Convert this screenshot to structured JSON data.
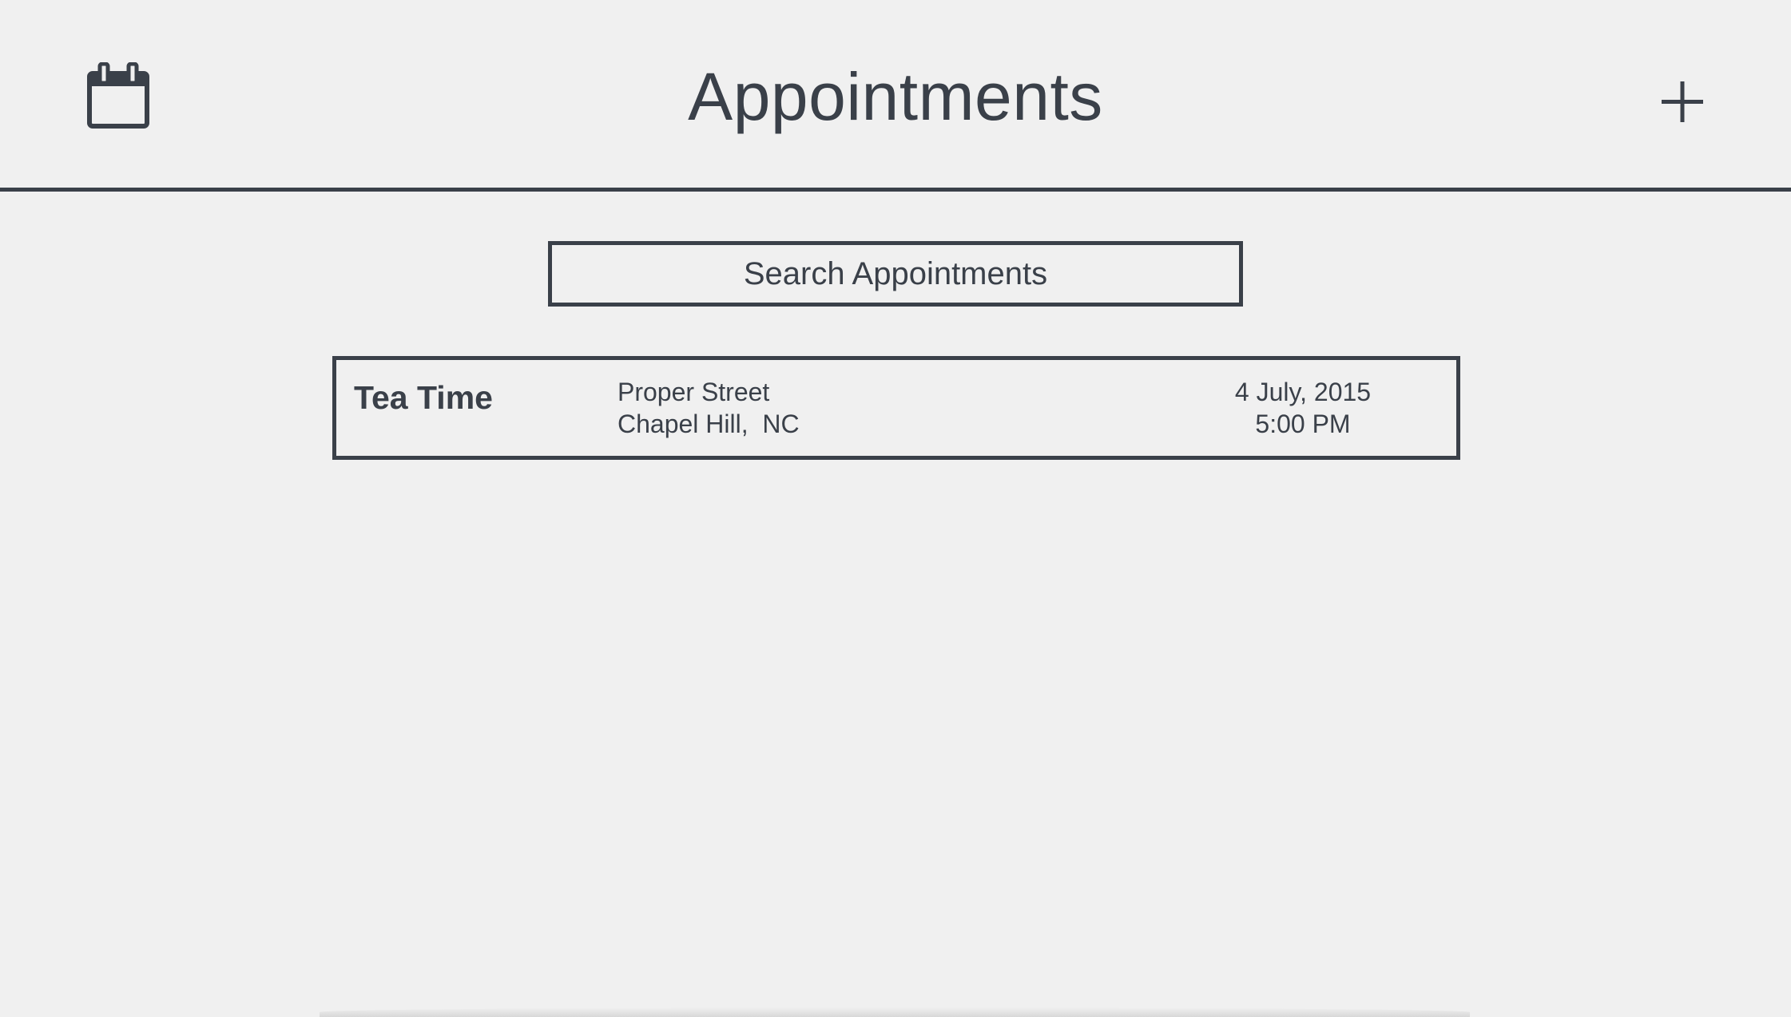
{
  "header": {
    "title": "Appointments",
    "calendar_icon": "calendar-icon",
    "add_icon": "plus-icon",
    "add_glyph": "+"
  },
  "search": {
    "placeholder": "Search Appointments",
    "value": ""
  },
  "appointments": [
    {
      "title": "Tea Time",
      "street": "Proper Street",
      "city_state": "Chapel Hill,  NC",
      "date": "4 July, 2015",
      "time": "5:00 PM"
    }
  ],
  "colors": {
    "background": "#f0f0f0",
    "foreground": "#3a4049"
  }
}
